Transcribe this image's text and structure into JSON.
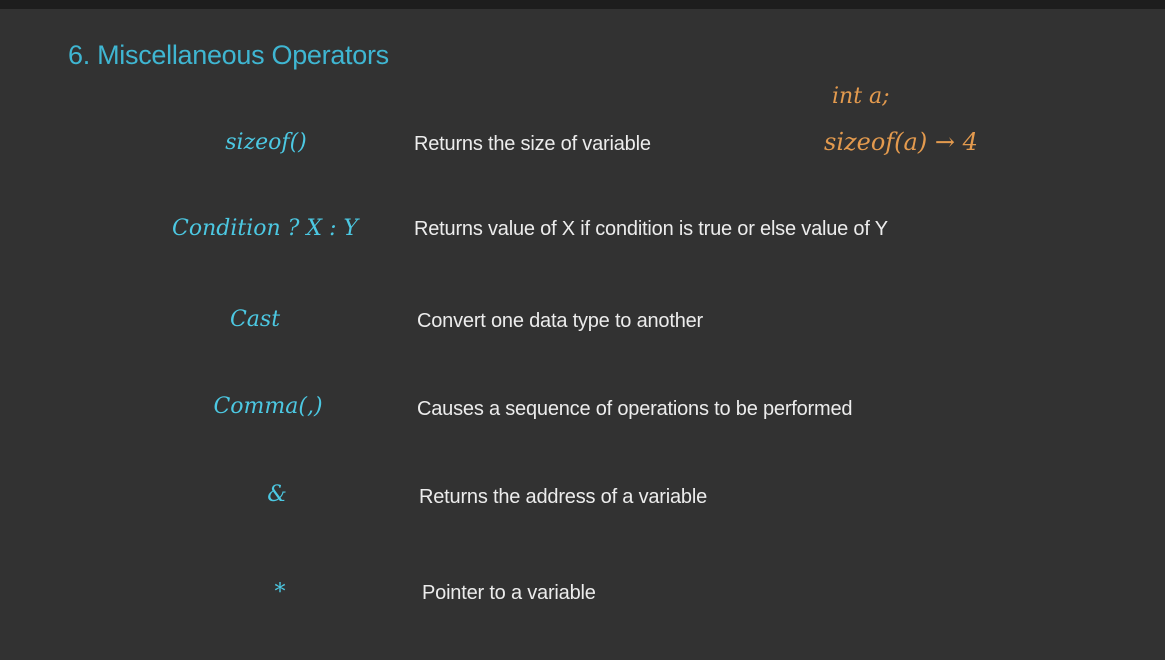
{
  "slide": {
    "title": "6. Miscellaneous Operators",
    "rows": [
      {
        "operator": "sizeof()",
        "description": "Returns the size of variable"
      },
      {
        "operator": "Condition ? X : Y",
        "description": "Returns value of X if condition is true or else value of Y"
      },
      {
        "operator": "Cast",
        "description": "Convert one data type to another"
      },
      {
        "operator": "Comma(,)",
        "description": "Causes a sequence of operations to be performed"
      },
      {
        "operator": "&",
        "description": "Returns the address of a variable"
      },
      {
        "operator": "*",
        "description": "Pointer to a variable"
      }
    ],
    "annotation": {
      "line1": "int a;",
      "line2": "sizeof(a) → 4"
    }
  },
  "colors": {
    "background": "#323232",
    "title": "#3fb6d2",
    "handwriting_operator": "#4cc8e2",
    "handwriting_annotation": "#e39a4e",
    "description_text": "#ececec"
  }
}
